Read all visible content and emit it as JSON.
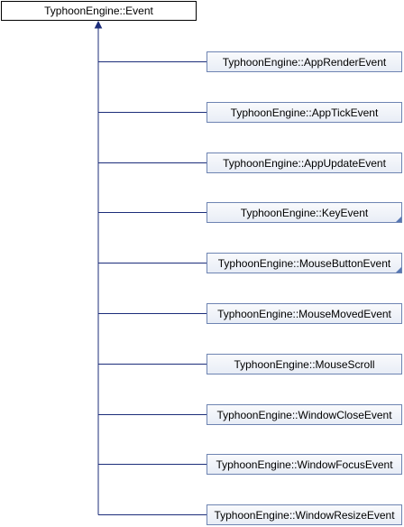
{
  "diagram": {
    "base_class": {
      "label": "TyphoonEngine::Event"
    },
    "derived_classes": [
      {
        "label": "TyphoonEngine::AppRenderEvent",
        "has_more": false
      },
      {
        "label": "TyphoonEngine::AppTickEvent",
        "has_more": false
      },
      {
        "label": "TyphoonEngine::AppUpdateEvent",
        "has_more": false
      },
      {
        "label": "TyphoonEngine::KeyEvent",
        "has_more": true
      },
      {
        "label": "TyphoonEngine::MouseButtonEvent",
        "has_more": true
      },
      {
        "label": "TyphoonEngine::MouseMovedEvent",
        "has_more": false
      },
      {
        "label": "TyphoonEngine::MouseScroll",
        "has_more": false
      },
      {
        "label": "TyphoonEngine::WindowCloseEvent",
        "has_more": false
      },
      {
        "label": "TyphoonEngine::WindowFocusEvent",
        "has_more": false
      },
      {
        "label": "TyphoonEngine::WindowResizeEvent",
        "has_more": false
      }
    ],
    "colors": {
      "connector": "#1c2d7a",
      "node_border": "#6e84b2",
      "node_fill_top": "#f9fafc",
      "node_fill_bottom": "#e8edf6",
      "base_border": "#000000"
    }
  }
}
